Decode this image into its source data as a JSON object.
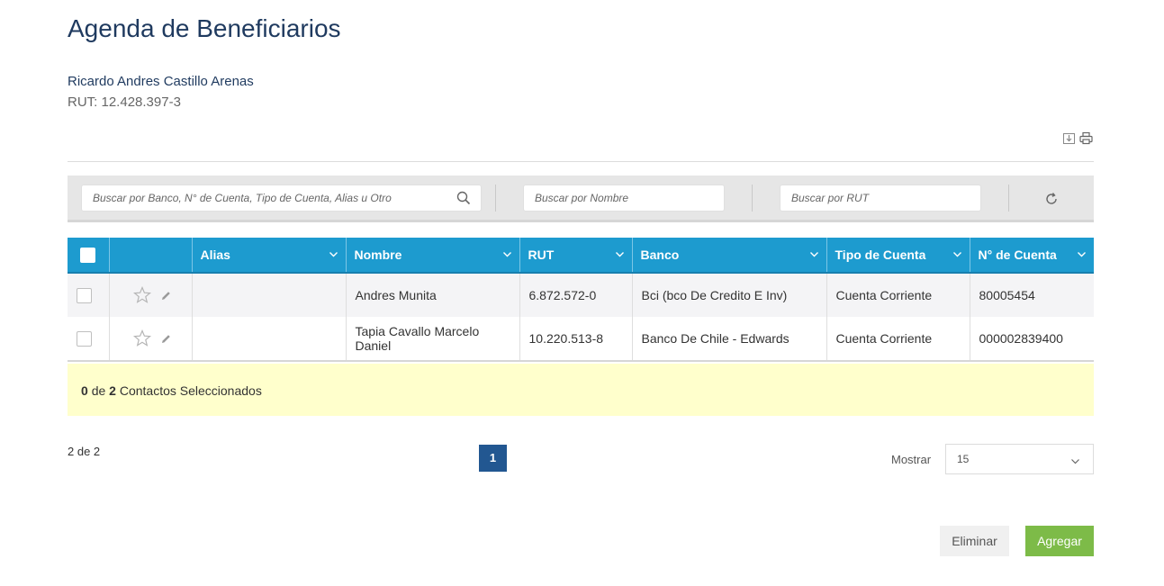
{
  "page": {
    "title": "Agenda de Beneficiarios"
  },
  "user": {
    "name": "Ricardo Andres Castillo Arenas",
    "rut": "RUT: 12.428.397-3"
  },
  "toolbar": {
    "icons": [
      "download-icon",
      "print-icon"
    ]
  },
  "filters": {
    "general_placeholder": "Buscar por Banco, N° de Cuenta, Tipo de Cuenta, Alias u Otro",
    "name_placeholder": "Buscar por Nombre",
    "rut_placeholder": "Buscar por RUT"
  },
  "table": {
    "columns": [
      "Alias",
      "Nombre",
      "RUT",
      "Banco",
      "Tipo de Cuenta",
      "N° de Cuenta"
    ],
    "rows": [
      {
        "alias": "",
        "nombre": "Andres Munita",
        "rut": "6.872.572-0",
        "banco": "Bci (bco De Credito E Inv)",
        "tipo": "Cuenta Corriente",
        "cuenta": "80005454"
      },
      {
        "alias": "",
        "nombre": "Tapia Cavallo Marcelo Daniel",
        "rut": "10.220.513-8",
        "banco": "Banco De Chile - Edwards",
        "tipo": "Cuenta Corriente",
        "cuenta": "000002839400"
      }
    ]
  },
  "selection": {
    "selected": "0",
    "of_label": "de",
    "total": "2",
    "suffix": "Contactos Seleccionados"
  },
  "pagination": {
    "count_label": "2 de 2",
    "current_page": "1",
    "show_label": "Mostrar",
    "page_size": "15"
  },
  "actions": {
    "delete_label": "Eliminar",
    "add_label": "Agregar"
  },
  "colors": {
    "header_blue": "#1d9bcf",
    "page_blue": "#225791",
    "add_green": "#7dbb48",
    "selection_yellow": "#ffffcc"
  }
}
